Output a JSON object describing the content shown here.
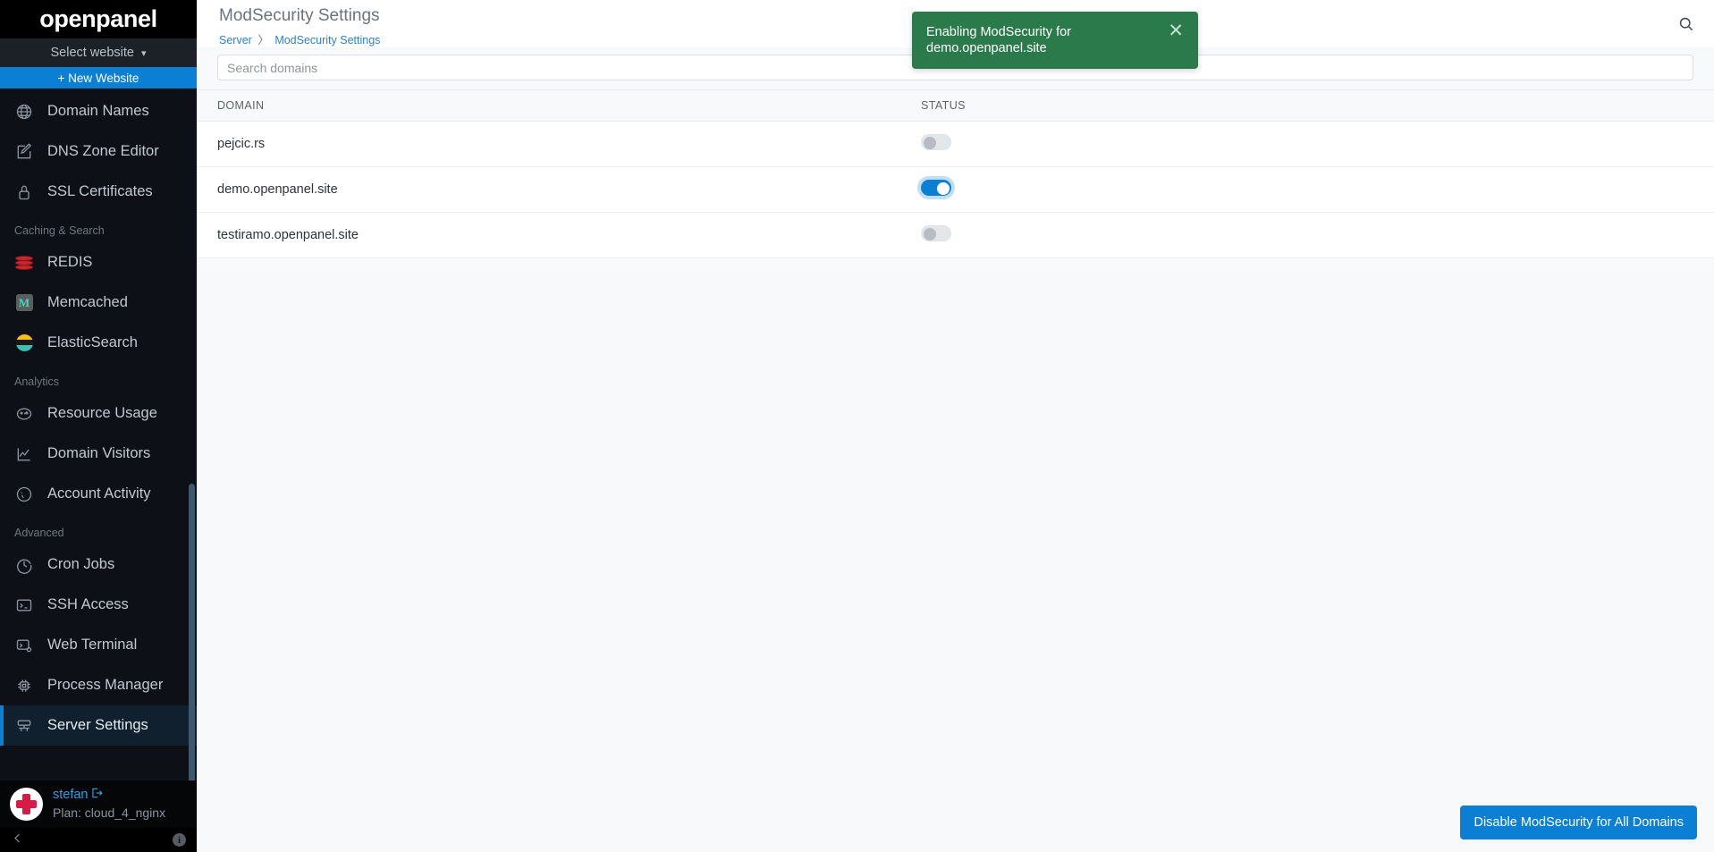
{
  "brand": {
    "name": "openpanel"
  },
  "sidebar": {
    "site_select": {
      "label": "Select website",
      "chevron": "chevron-down-icon"
    },
    "new_website": {
      "label": "+ New Website"
    },
    "groups": [
      {
        "title": null,
        "items": [
          {
            "label": "Domain Names",
            "icon": "globe-icon",
            "active": false
          },
          {
            "label": "DNS Zone Editor",
            "icon": "edit-square-icon",
            "active": false
          },
          {
            "label": "SSL Certificates",
            "icon": "lock-icon",
            "active": false
          }
        ]
      },
      {
        "title": "Caching & Search",
        "items": [
          {
            "label": "REDIS",
            "icon": "redis-icon",
            "active": false
          },
          {
            "label": "Memcached",
            "icon": "memcached-icon",
            "active": false
          },
          {
            "label": "ElasticSearch",
            "icon": "elasticsearch-icon",
            "active": false
          }
        ]
      },
      {
        "title": "Analytics",
        "items": [
          {
            "label": "Resource Usage",
            "icon": "gauge-icon",
            "active": false
          },
          {
            "label": "Domain Visitors",
            "icon": "line-chart-icon",
            "active": false
          },
          {
            "label": "Account Activity",
            "icon": "globe-activity-icon",
            "active": false
          }
        ]
      },
      {
        "title": "Advanced",
        "items": [
          {
            "label": "Cron Jobs",
            "icon": "clock-icon",
            "active": false
          },
          {
            "label": "SSH Access",
            "icon": "terminal-icon",
            "active": false
          },
          {
            "label": "Web Terminal",
            "icon": "terminal-gear-icon",
            "active": false
          },
          {
            "label": "Process Manager",
            "icon": "cpu-icon",
            "active": false
          },
          {
            "label": "Server Settings",
            "icon": "server-icon",
            "active": true
          }
        ]
      }
    ],
    "user": {
      "name": "stefan",
      "logout_icon": "logout-icon",
      "plan": "Plan: cloud_4_nginx",
      "avatar": "red-cross-avatar"
    },
    "footer": {
      "collapse_icon": "chevron-left-icon",
      "info_icon": "info-icon",
      "info_glyph": "i"
    }
  },
  "header": {
    "title": "ModSecurity Settings",
    "breadcrumb": {
      "parent": "Server",
      "separator": "〉",
      "current": "ModSecurity Settings"
    },
    "search_icon": "search-icon"
  },
  "search": {
    "placeholder": "Search domains",
    "value": ""
  },
  "table": {
    "columns": [
      "DOMAIN",
      "STATUS"
    ],
    "rows": [
      {
        "domain": "pejcic.rs",
        "enabled": false
      },
      {
        "domain": "demo.openpanel.site",
        "enabled": true
      },
      {
        "domain": "testiramo.openpanel.site",
        "enabled": false
      }
    ]
  },
  "toast": {
    "message": "Enabling ModSecurity for demo.openpanel.site",
    "close_icon": "close-icon",
    "color": "#2b7a4b"
  },
  "bottom_action": {
    "label": "Disable ModSecurity for All Domains"
  },
  "colors": {
    "accent": "#0a7fd4",
    "sidebar_bg": "#0d1117",
    "success": "#2b7a4b"
  }
}
